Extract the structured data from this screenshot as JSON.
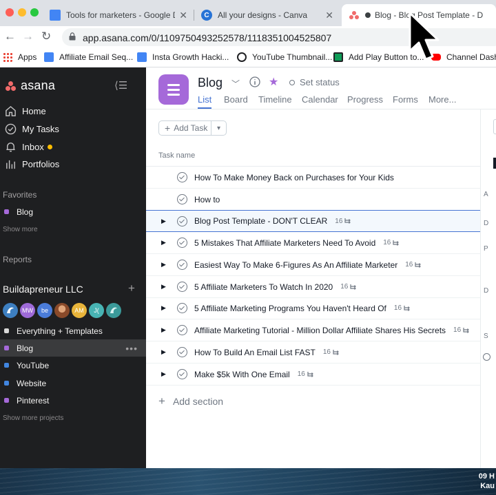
{
  "browser": {
    "tabs": [
      {
        "title": "Tools for marketers - Google Do",
        "icon": "google-docs-icon"
      },
      {
        "title": "All your designs - Canva",
        "icon": "canva-icon"
      },
      {
        "title": "Blog - Blog Post Template - D",
        "icon": "asana-icon",
        "active": true
      }
    ],
    "url": "app.asana.com/0/1109750493252578/1118351004525807",
    "bookmarks": [
      "Apps",
      "Affiliate Email Seq...",
      "Insta Growth Hacki...",
      "YouTube Thumbnail...",
      "Add Play Button to...",
      "Channel Dashb"
    ]
  },
  "sidebar": {
    "logo": "asana",
    "nav": [
      {
        "label": "Home",
        "icon": "home-icon"
      },
      {
        "label": "My Tasks",
        "icon": "check-circle-icon"
      },
      {
        "label": "Inbox",
        "icon": "bell-icon"
      },
      {
        "label": "Portfolios",
        "icon": "bar-chart-icon"
      }
    ],
    "favorites_label": "Favorites",
    "favorites": [
      {
        "label": "Blog",
        "color": "#a569d9"
      }
    ],
    "show_more": "Show more",
    "reports_label": "Reports",
    "team": {
      "name": "Buildapreneur LLC",
      "avatars": [
        {
          "initials": "",
          "color": "#3d7fc1"
        },
        {
          "initials": "MW",
          "color": "#9e6ad8"
        },
        {
          "initials": "be",
          "color": "#4a7cd9"
        },
        {
          "initials": "",
          "color": "#b5673f"
        },
        {
          "initials": "AM",
          "color": "#e8b43a"
        },
        {
          "initials": "J(",
          "color": "#48b4b4"
        },
        {
          "initials": "",
          "color": "#3b9a9a"
        }
      ]
    },
    "projects": [
      {
        "label": "Everything + Templates",
        "color": "#d8d8d8"
      },
      {
        "label": "Blog",
        "color": "#a569d9",
        "selected": true
      },
      {
        "label": "YouTube",
        "color": "#4186e0"
      },
      {
        "label": "Website",
        "color": "#4186e0"
      },
      {
        "label": "Pinterest",
        "color": "#a569d9"
      }
    ],
    "show_more_projects": "Show more projects"
  },
  "project": {
    "title": "Blog",
    "set_status": "Set status",
    "tabs": [
      "List",
      "Board",
      "Timeline",
      "Calendar",
      "Progress",
      "Forms",
      "More..."
    ],
    "add_task": "Add Task",
    "column_header": "Task name",
    "tasks": [
      {
        "name": "How To Make Money Back on Purchases for Your Kids",
        "subtasks": "",
        "expandable": false
      },
      {
        "name": "How to",
        "subtasks": "",
        "expandable": false
      },
      {
        "name": "Blog Post Template - DON'T CLEAR",
        "subtasks": "16",
        "expandable": true,
        "highlighted": true
      },
      {
        "name": "5 Mistakes That Affiliate Marketers Need To Avoid",
        "subtasks": "16",
        "expandable": true
      },
      {
        "name": "Easiest Way To Make 6-Figures As An Affiliate Marketer",
        "subtasks": "16",
        "expandable": true
      },
      {
        "name": "5 Affiliate Marketers To Watch In 2020",
        "subtasks": "16",
        "expandable": true
      },
      {
        "name": "5 Affiliate Marketing Programs You Haven't Heard Of",
        "subtasks": "16",
        "expandable": true
      },
      {
        "name": "Affiliate Marketing Tutorial - Million Dollar Affiliate Shares His Secrets",
        "subtasks": "16",
        "expandable": true
      },
      {
        "name": "How To Build An Email List FAST",
        "subtasks": "16",
        "expandable": true
      },
      {
        "name": "Make $5k With One Email",
        "subtasks": "16",
        "expandable": true
      }
    ],
    "add_section": "Add section"
  },
  "right_panel_chars": [
    "A",
    "D",
    "P",
    "D",
    "S"
  ],
  "clock": {
    "line1": "09 H",
    "line2": "Kau"
  }
}
